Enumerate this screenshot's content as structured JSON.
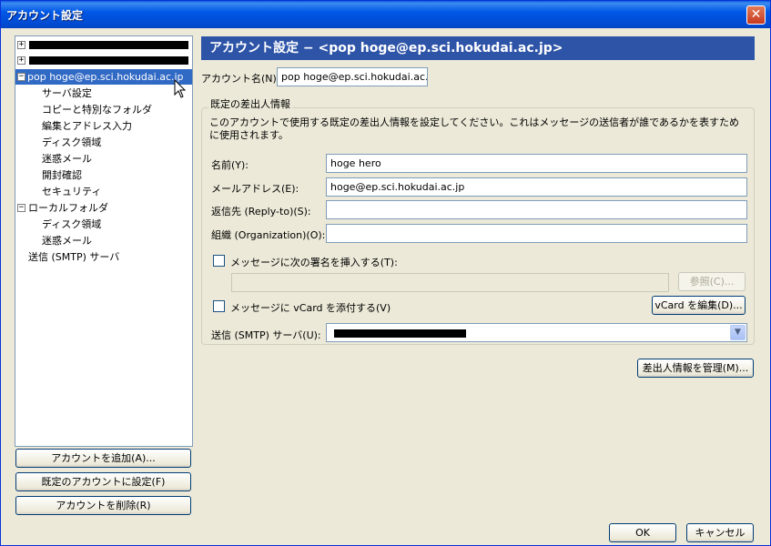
{
  "window": {
    "title": "アカウント設定",
    "close": "✕"
  },
  "tree": {
    "expand_plus": "+",
    "expand_minus": "−",
    "account": "pop hoge@ep.sci.hokudai.ac.jp",
    "account_items": [
      "サーバ設定",
      "コピーと特別なフォルダ",
      "編集とアドレス入力",
      "ディスク領域",
      "迷惑メール",
      "開封確認",
      "セキュリティ"
    ],
    "local_folders": "ローカルフォルダ",
    "local_items": [
      "ディスク領域",
      "迷惑メール"
    ],
    "smtp": "送信 (SMTP) サーバ"
  },
  "left_buttons": {
    "add": "アカウントを追加(A)...",
    "default": "既定のアカウントに設定(F)",
    "delete": "アカウントを削除(R)"
  },
  "panel": {
    "header": "アカウント設定 − <pop hoge@ep.sci.hokudai.ac.jp>",
    "account_name_label": "アカウント名(N):",
    "account_name_value": "pop hoge@ep.sci.hokudai.ac.jp",
    "identity_group_title": "既定の差出人情報",
    "identity_desc": "このアカウントで使用する既定の差出人情報を設定してください。これはメッセージの送信者が誰であるかを表すために使用されます。",
    "name_label": "名前(Y):",
    "name_value": "hoge hero",
    "email_label": "メールアドレス(E):",
    "email_value": "hoge@ep.sci.hokudai.ac.jp",
    "replyto_label": "返信先 (Reply-to)(S):",
    "replyto_value": "",
    "org_label": "組織 (Organization)(O):",
    "org_value": "",
    "signature_label": "メッセージに次の署名を挿入する(T):",
    "signature_path": "",
    "browse_button": "参照(C)...",
    "vcard_label": "メッセージに vCard を添付する(V)",
    "vcard_edit_button": "vCard を編集(D)...",
    "smtp_label": "送信 (SMTP) サーバ(U):",
    "smtp_arrow": "▼",
    "manage_identities_button": "差出人情報を管理(M)...",
    "ok_button": "OK",
    "cancel_button": "キャンセル"
  }
}
